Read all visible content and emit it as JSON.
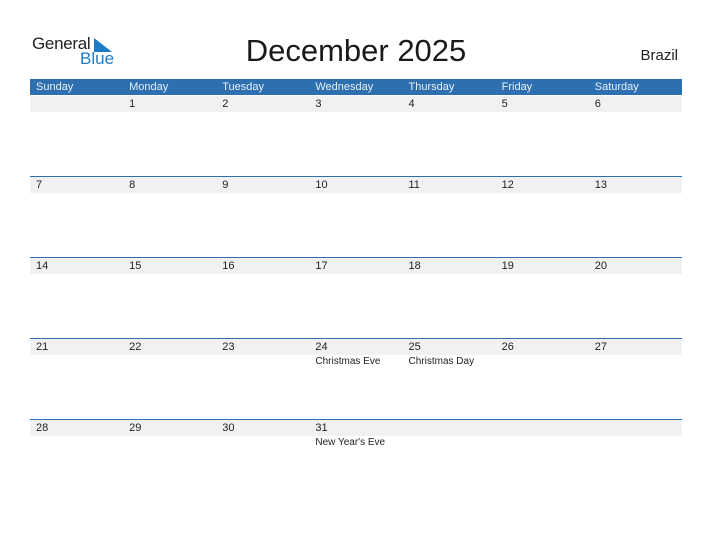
{
  "logo": {
    "line1": "General",
    "line2": "Blue"
  },
  "title": "December 2025",
  "country": "Brazil",
  "colors": {
    "header": "#2e6fb0",
    "band": "#f1f1f1",
    "logo_blue": "#1e7bc6"
  },
  "weekdays": [
    "Sunday",
    "Monday",
    "Tuesday",
    "Wednesday",
    "Thursday",
    "Friday",
    "Saturday"
  ],
  "weeks": [
    {
      "days": [
        "",
        "1",
        "2",
        "3",
        "4",
        "5",
        "6"
      ],
      "events": [
        "",
        "",
        "",
        "",
        "",
        "",
        ""
      ]
    },
    {
      "days": [
        "7",
        "8",
        "9",
        "10",
        "11",
        "12",
        "13"
      ],
      "events": [
        "",
        "",
        "",
        "",
        "",
        "",
        ""
      ]
    },
    {
      "days": [
        "14",
        "15",
        "16",
        "17",
        "18",
        "19",
        "20"
      ],
      "events": [
        "",
        "",
        "",
        "",
        "",
        "",
        ""
      ]
    },
    {
      "days": [
        "21",
        "22",
        "23",
        "24",
        "25",
        "26",
        "27"
      ],
      "events": [
        "",
        "",
        "",
        "Christmas Eve",
        "Christmas Day",
        "",
        ""
      ]
    },
    {
      "days": [
        "28",
        "29",
        "30",
        "31",
        "",
        "",
        ""
      ],
      "events": [
        "",
        "",
        "",
        "New Year's Eve",
        "",
        "",
        ""
      ]
    }
  ]
}
